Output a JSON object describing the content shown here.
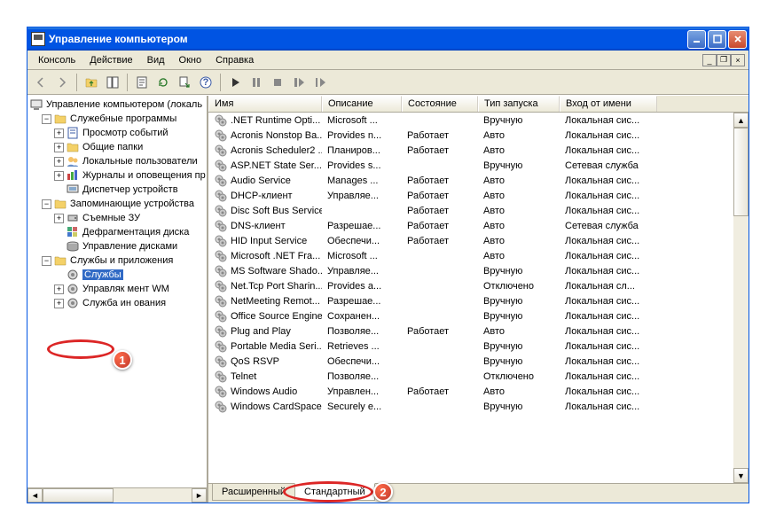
{
  "window": {
    "title": "Управление компьютером"
  },
  "menus": [
    "Консоль",
    "Действие",
    "Вид",
    "Окно",
    "Справка"
  ],
  "tree": {
    "root": "Управление компьютером (локаль",
    "groups": [
      {
        "label": "Служебные программы",
        "expanded": true,
        "children": [
          "Просмотр событий",
          "Общие папки",
          "Локальные пользователи",
          "Журналы и оповещения пр",
          "Диспетчер устройств"
        ]
      },
      {
        "label": "Запоминающие устройства",
        "expanded": true,
        "children": [
          "Съемные ЗУ",
          "Дефрагментация диска",
          "Управление дисками"
        ]
      },
      {
        "label": "Службы и приложения",
        "expanded": true,
        "children": [
          "Службы",
          "Управляк               мент WM",
          "Служба ин              ования"
        ]
      }
    ],
    "selected": "Службы"
  },
  "columns": [
    "Имя",
    "Описание",
    "Состояние",
    "Тип запуска",
    "Вход от имени"
  ],
  "services": [
    {
      "name": ".NET Runtime Opti...",
      "desc": "Microsoft ...",
      "state": "",
      "start": "Вручную",
      "logon": "Локальная сис..."
    },
    {
      "name": "Acronis Nonstop Ba...",
      "desc": "Provides n...",
      "state": "Работает",
      "start": "Авто",
      "logon": "Локальная сис..."
    },
    {
      "name": "Acronis Scheduler2 ...",
      "desc": "Планиров...",
      "state": "Работает",
      "start": "Авто",
      "logon": "Локальная сис..."
    },
    {
      "name": "ASP.NET State Ser...",
      "desc": "Provides s...",
      "state": "",
      "start": "Вручную",
      "logon": "Сетевая служба"
    },
    {
      "name": "Audio Service",
      "desc": "Manages ...",
      "state": "Работает",
      "start": "Авто",
      "logon": "Локальная сис..."
    },
    {
      "name": "DHCP-клиент",
      "desc": "Управляе...",
      "state": "Работает",
      "start": "Авто",
      "logon": "Локальная сис..."
    },
    {
      "name": "Disc Soft Bus Service",
      "desc": "",
      "state": "Работает",
      "start": "Авто",
      "logon": "Локальная сис..."
    },
    {
      "name": "DNS-клиент",
      "desc": "Разрешае...",
      "state": "Работает",
      "start": "Авто",
      "logon": "Сетевая служба"
    },
    {
      "name": "HID Input Service",
      "desc": "Обеспечи...",
      "state": "Работает",
      "start": "Авто",
      "logon": "Локальная сис..."
    },
    {
      "name": "Microsoft .NET Fra...",
      "desc": "Microsoft ...",
      "state": "",
      "start": "Авто",
      "logon": "Локальная сис..."
    },
    {
      "name": "MS Software Shado...",
      "desc": "Управляе...",
      "state": "",
      "start": "Вручную",
      "logon": "Локальная сис..."
    },
    {
      "name": "Net.Tcp Port Sharin...",
      "desc": "Provides a...",
      "state": "",
      "start": "Отключено",
      "logon": "Локальная сл..."
    },
    {
      "name": "NetMeeting Remot...",
      "desc": "Разрешае...",
      "state": "",
      "start": "Вручную",
      "logon": "Локальная сис..."
    },
    {
      "name": "Office Source Engine",
      "desc": "Сохранен...",
      "state": "",
      "start": "Вручную",
      "logon": "Локальная сис..."
    },
    {
      "name": "Plug and Play",
      "desc": "Позволяе...",
      "state": "Работает",
      "start": "Авто",
      "logon": "Локальная сис..."
    },
    {
      "name": "Portable Media Seri...",
      "desc": "Retrieves ...",
      "state": "",
      "start": "Вручную",
      "logon": "Локальная сис..."
    },
    {
      "name": "QoS RSVP",
      "desc": "Обеспечи...",
      "state": "",
      "start": "Вручную",
      "logon": "Локальная сис..."
    },
    {
      "name": "Telnet",
      "desc": "Позволяе...",
      "state": "",
      "start": "Отключено",
      "logon": "Локальная сис..."
    },
    {
      "name": "Windows Audio",
      "desc": "Управлен...",
      "state": "Работает",
      "start": "Авто",
      "logon": "Локальная сис..."
    },
    {
      "name": "Windows CardSpace",
      "desc": "Securely e...",
      "state": "",
      "start": "Вручную",
      "logon": "Локальная сис..."
    }
  ],
  "tabs": {
    "items": [
      "Расширенный",
      "Стандартный"
    ],
    "active": 1
  },
  "badges": {
    "one": "1",
    "two": "2"
  }
}
